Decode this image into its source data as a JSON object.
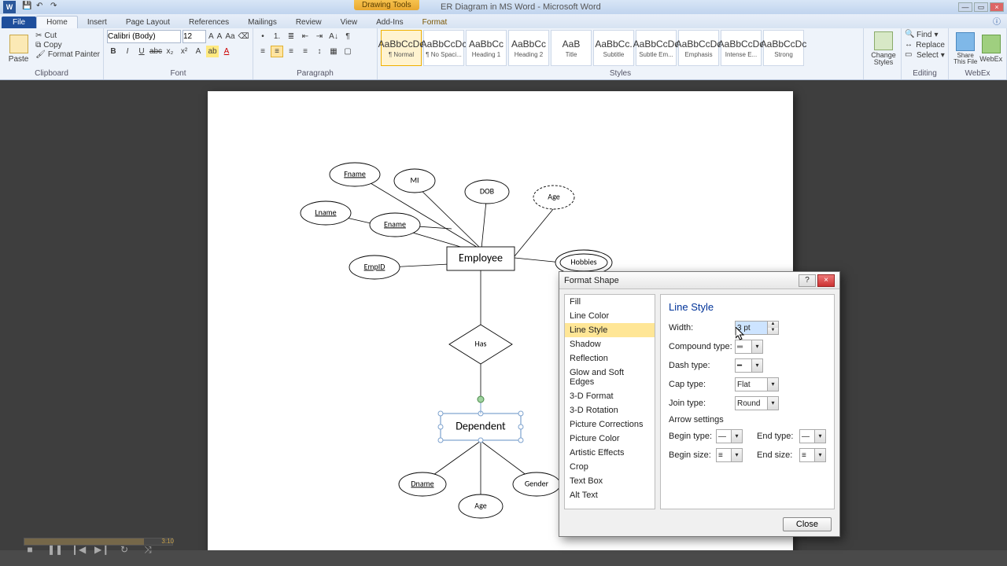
{
  "app": {
    "contextual_tab": "Drawing Tools",
    "doc_title": "ER Diagram in MS Word - Microsoft Word"
  },
  "tabs": {
    "file": "File",
    "items": [
      "Home",
      "Insert",
      "Page Layout",
      "References",
      "Mailings",
      "Review",
      "View",
      "Add-Ins"
    ],
    "contextual": "Format",
    "active": "Home"
  },
  "ribbon": {
    "clipboard": {
      "paste": "Paste",
      "cut": "Cut",
      "copy": "Copy",
      "format_painter": "Format Painter",
      "label": "Clipboard"
    },
    "font": {
      "family": "Calibri (Body)",
      "size": "12",
      "label": "Font"
    },
    "paragraph": {
      "label": "Paragraph"
    },
    "styles": {
      "label": "Styles",
      "items": [
        {
          "preview": "AaBbCcDc",
          "name": "¶ Normal",
          "sel": true
        },
        {
          "preview": "AaBbCcDc",
          "name": "¶ No Spaci...",
          "sel": false
        },
        {
          "preview": "AaBbCc",
          "name": "Heading 1",
          "sel": false
        },
        {
          "preview": "AaBbCc",
          "name": "Heading 2",
          "sel": false
        },
        {
          "preview": "AaB",
          "name": "Title",
          "sel": false
        },
        {
          "preview": "AaBbCc.",
          "name": "Subtitle",
          "sel": false
        },
        {
          "preview": "AaBbCcDc",
          "name": "Subtle Em...",
          "sel": false
        },
        {
          "preview": "AaBbCcDc",
          "name": "Emphasis",
          "sel": false
        },
        {
          "preview": "AaBbCcDc",
          "name": "Intense E...",
          "sel": false
        },
        {
          "preview": "AaBbCcDc",
          "name": "Strong",
          "sel": false
        }
      ],
      "change": "Change Styles"
    },
    "editing": {
      "find": "Find",
      "replace": "Replace",
      "select": "Select",
      "label": "Editing"
    },
    "webex": {
      "share": "Share This File",
      "webex": "WebEx",
      "label": "WebEx"
    }
  },
  "er": {
    "employee": "Employee",
    "fname": "Fname",
    "mi": "MI",
    "dob": "DOB",
    "age_emp": "Age",
    "hobbies": "Hobbies",
    "ename": "Ename",
    "lname": "Lname",
    "empid": "EmpID",
    "has": "Has",
    "dependent": "Dependent",
    "dname": "Dname",
    "age_dep": "Age",
    "gender": "Gender"
  },
  "dialog": {
    "title": "Format Shape",
    "categories": [
      "Fill",
      "Line Color",
      "Line Style",
      "Shadow",
      "Reflection",
      "Glow and Soft Edges",
      "3-D Format",
      "3-D Rotation",
      "Picture Corrections",
      "Picture Color",
      "Artistic Effects",
      "Crop",
      "Text Box",
      "Alt Text"
    ],
    "selected_category": "Line Style",
    "pane_title": "Line Style",
    "width_label": "Width:",
    "width_value": "3 pt",
    "compound_label": "Compound type:",
    "dash_label": "Dash type:",
    "cap_label": "Cap type:",
    "cap_value": "Flat",
    "join_label": "Join type:",
    "join_value": "Round",
    "arrow_header": "Arrow settings",
    "begin_type": "Begin type:",
    "end_type": "End type:",
    "begin_size": "Begin size:",
    "end_size": "End size:",
    "close": "Close"
  },
  "seek_time": "3:10"
}
